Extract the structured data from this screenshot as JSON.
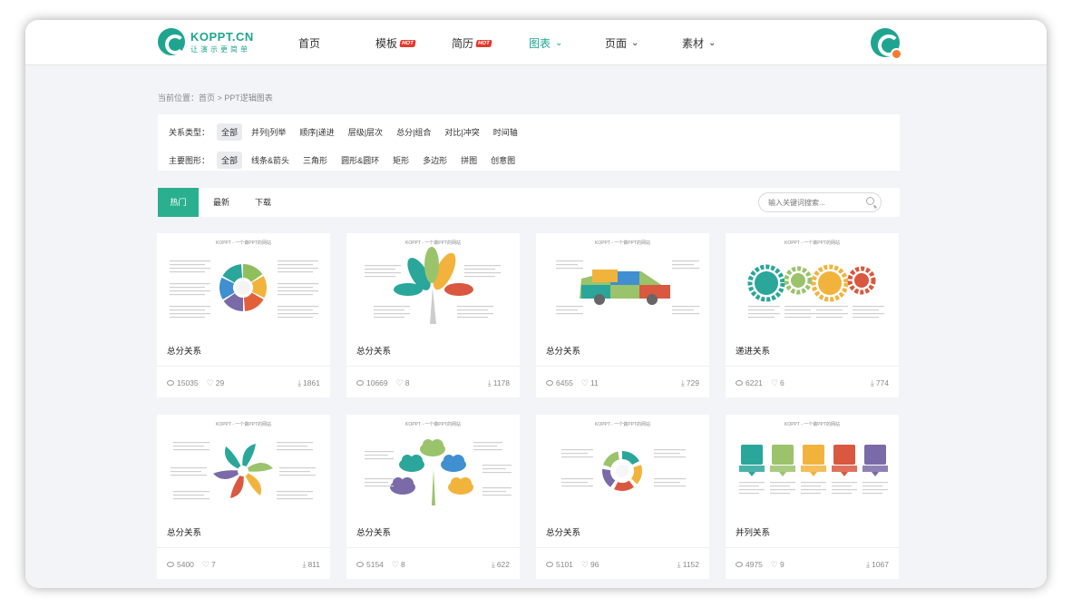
{
  "logo": {
    "name": "KOPPT.CN",
    "slogan": "让演示更简单"
  },
  "nav": [
    {
      "label": "首页",
      "hot": "",
      "chevron": false,
      "active": false
    },
    {
      "label": "模板",
      "hot": "HOT",
      "chevron": false,
      "active": false
    },
    {
      "label": "简历",
      "hot": "HOT",
      "chevron": false,
      "active": false
    },
    {
      "label": "图表",
      "hot": "",
      "chevron": true,
      "active": true
    },
    {
      "label": "页面",
      "hot": "",
      "chevron": true,
      "active": false
    },
    {
      "label": "素材",
      "hot": "",
      "chevron": true,
      "active": false
    }
  ],
  "breadcrumb": "当前位置：首页 > PPT逻辑图表",
  "filters": {
    "relation": {
      "label": "关系类型：",
      "options": [
        "全部",
        "并列|列举",
        "顺序|递进",
        "层级|层次",
        "总分|组合",
        "对比|冲突",
        "时间轴"
      ],
      "selected": 0
    },
    "shape": {
      "label": "主要图形：",
      "options": [
        "全部",
        "线条&箭头",
        "三角形",
        "圆形&圆环",
        "矩形",
        "多边形",
        "拼图",
        "创意图"
      ],
      "selected": 0
    }
  },
  "tabs": [
    "热门",
    "最新",
    "下载"
  ],
  "search": {
    "placeholder": "输入关键词搜索..."
  },
  "thumb_caption": "KOPPT - 一个做PPT的网站",
  "cards": [
    {
      "title": "总分关系",
      "views": "15035",
      "likes": "29",
      "downloads": "1861",
      "art": "wheel"
    },
    {
      "title": "总分关系",
      "views": "10669",
      "likes": "8",
      "downloads": "1178",
      "art": "tree"
    },
    {
      "title": "总分关系",
      "views": "6455",
      "likes": "11",
      "downloads": "729",
      "art": "car"
    },
    {
      "title": "递进关系",
      "views": "6221",
      "likes": "6",
      "downloads": "774",
      "art": "gears"
    },
    {
      "title": "总分关系",
      "views": "5400",
      "likes": "7",
      "downloads": "811",
      "art": "pinwheel"
    },
    {
      "title": "总分关系",
      "views": "5154",
      "likes": "8",
      "downloads": "622",
      "art": "cloudtree"
    },
    {
      "title": "总分关系",
      "views": "5101",
      "likes": "96",
      "downloads": "1152",
      "art": "swirl"
    },
    {
      "title": "并列关系",
      "views": "4975",
      "likes": "9",
      "downloads": "1067",
      "art": "boxes"
    }
  ],
  "colors": {
    "brand": "#1fa58f",
    "tab_active": "#2bb08f",
    "hot": "#e0392b"
  }
}
